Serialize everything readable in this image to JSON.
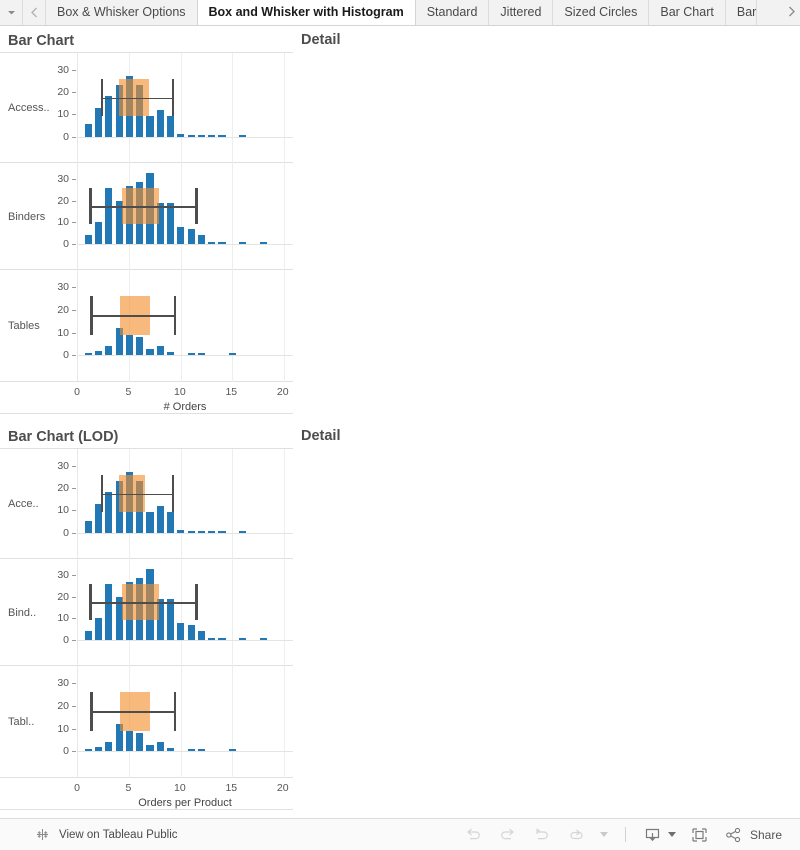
{
  "tabs": {
    "prev_icon": "chevron-left-icon",
    "next_icon": "chevron-right-icon",
    "menu_icon": "caret-down-icon",
    "items": [
      {
        "label": "Box & Whisker Options",
        "active": false
      },
      {
        "label": "Box and Whisker with Histogram",
        "active": true
      },
      {
        "label": "Standard",
        "active": false
      },
      {
        "label": "Jittered",
        "active": false
      },
      {
        "label": "Sized Circles",
        "active": false
      },
      {
        "label": "Bar Chart",
        "active": false
      },
      {
        "label": "Bar",
        "active": false
      }
    ]
  },
  "sheets": [
    {
      "title": "Bar Chart",
      "detail_title": "Detail"
    },
    {
      "title": "Bar Chart (LOD)",
      "detail_title": "Detail"
    }
  ],
  "toolbar": {
    "logo_icon": "tableau-logo-icon",
    "view_label": "View on Tableau Public",
    "undo_icon": "undo-icon",
    "redo_icon": "redo-icon",
    "revert_icon": "revert-icon",
    "refresh_icon": "refresh-icon",
    "refresh_caret_icon": "caret-down-icon",
    "download_icon": "download-icon",
    "download_caret_icon": "caret-down-icon",
    "fullscreen_icon": "fullscreen-icon",
    "share_icon": "share-icon",
    "share_label": "Share"
  },
  "colors": {
    "bar": "#2278b5",
    "box": "#f28e2b",
    "whisker": "#4d4d4d",
    "grid": "#eeeeee",
    "text": "#555555"
  },
  "chart_data": [
    {
      "type": "bar",
      "title": "Bar Chart",
      "xlabel": "# Orders",
      "ylabel": "",
      "xlim": [
        0,
        21
      ],
      "ylim": [
        -2,
        33
      ],
      "yticks": [
        0,
        10,
        20,
        30
      ],
      "xticks": [
        0,
        5,
        10,
        15,
        20
      ],
      "grid": true,
      "panels": [
        {
          "name": "Access..",
          "x": [
            1,
            2,
            3,
            4,
            5,
            6,
            7,
            8,
            9,
            10,
            11,
            12,
            13,
            14,
            16
          ],
          "values": [
            5.5,
            13,
            18,
            23,
            27,
            23,
            9,
            12,
            9,
            1,
            0.8,
            0.4,
            0.4,
            0,
            0.3
          ],
          "box": {
            "q1": 4,
            "median": 5.5,
            "q3": 6.9,
            "lower": 2.3,
            "upper": 9.2
          }
        },
        {
          "name": "Binders",
          "x": [
            1,
            2,
            3,
            4,
            5,
            6,
            7,
            8,
            9,
            10,
            11,
            12,
            13,
            14,
            16,
            18
          ],
          "values": [
            4.3,
            10,
            26,
            20,
            27,
            29,
            33,
            19,
            19,
            8,
            7,
            4.3,
            0.7,
            0,
            0.6,
            0.8
          ],
          "box": {
            "q1": 4.3,
            "median": 6.7,
            "q3": 7.9,
            "lower": 1.2,
            "upper": 11.5
          }
        },
        {
          "name": "Tables",
          "x": [
            1,
            2,
            3,
            4,
            5,
            6,
            7,
            8,
            9,
            11,
            12,
            15
          ],
          "values": [
            0.8,
            1.8,
            4,
            12,
            9,
            8,
            3,
            4,
            1.6,
            0.7,
            0.8,
            0.7
          ],
          "box": {
            "q1": 4.1,
            "median": 4.6,
            "q3": 7.0,
            "lower": 1.3,
            "upper": 9.4
          }
        }
      ]
    },
    {
      "type": "bar",
      "title": "Bar Chart (LOD)",
      "xlabel": "Orders per Product",
      "ylabel": "",
      "xlim": [
        0,
        21
      ],
      "ylim": [
        -2,
        33
      ],
      "yticks": [
        0,
        10,
        20,
        30
      ],
      "xticks": [
        0,
        5,
        10,
        15,
        20
      ],
      "grid": true,
      "panels": [
        {
          "name": "Acce..",
          "x": [
            1,
            2,
            3,
            4,
            5,
            6,
            7,
            8,
            9,
            10,
            11,
            12,
            13,
            14,
            16
          ],
          "values": [
            5,
            13,
            18,
            23,
            27,
            23,
            9,
            12,
            9,
            1,
            0.8,
            0.4,
            0.4,
            0,
            0.3
          ],
          "box": {
            "q1": 4,
            "median": 5.4,
            "q3": 6.5,
            "lower": 2.3,
            "upper": 9.2
          }
        },
        {
          "name": "Bind..",
          "x": [
            1,
            2,
            3,
            4,
            5,
            6,
            7,
            8,
            9,
            10,
            11,
            12,
            13,
            14,
            16,
            18
          ],
          "values": [
            4.3,
            10,
            26,
            20,
            27,
            29,
            33,
            19,
            19,
            8,
            7,
            4.3,
            0.7,
            0,
            0.6,
            0.8
          ],
          "box": {
            "q1": 4.3,
            "median": 6.8,
            "q3": 7.9,
            "lower": 1.2,
            "upper": 11.5
          }
        },
        {
          "name": "Tabl..",
          "x": [
            1,
            2,
            3,
            4,
            5,
            6,
            7,
            8,
            9,
            11,
            12,
            15
          ],
          "values": [
            0.8,
            1.8,
            4,
            12,
            9,
            8,
            3,
            4,
            1.6,
            0.7,
            0.8,
            0.7
          ],
          "box": {
            "q1": 4.1,
            "median": 4.6,
            "q3": 7.0,
            "lower": 1.3,
            "upper": 9.4
          }
        }
      ]
    }
  ]
}
